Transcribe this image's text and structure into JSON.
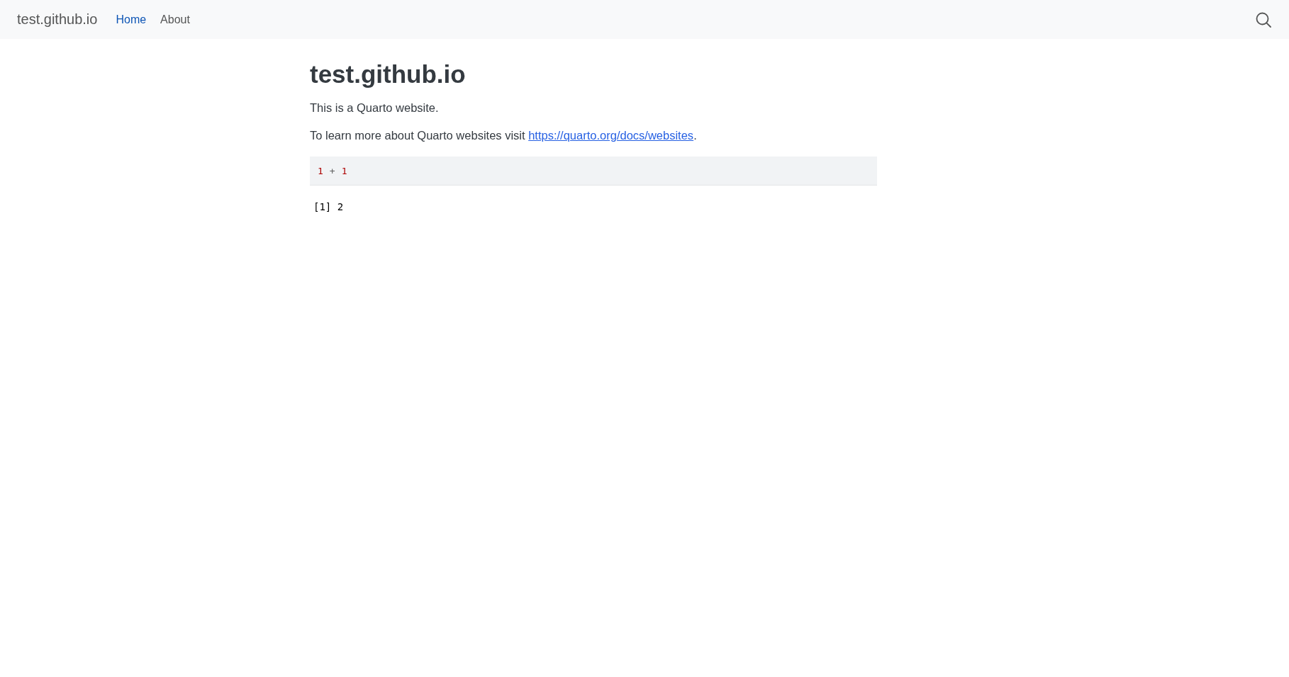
{
  "navbar": {
    "brand": "test.github.io",
    "items": [
      {
        "label": "Home",
        "selected": true
      },
      {
        "label": "About",
        "selected": false
      }
    ]
  },
  "page": {
    "title": "test.github.io",
    "intro": "This is a Quarto website.",
    "learn_more": {
      "before": "To learn more about Quarto websites visit ",
      "link": "https://quarto.org/docs/websites",
      "after": "."
    },
    "code": [
      {
        "kind": "number",
        "text": "1"
      },
      {
        "kind": "operator",
        "text": "+"
      },
      {
        "kind": "number",
        "text": "1"
      }
    ],
    "output": "[1] 2"
  }
}
